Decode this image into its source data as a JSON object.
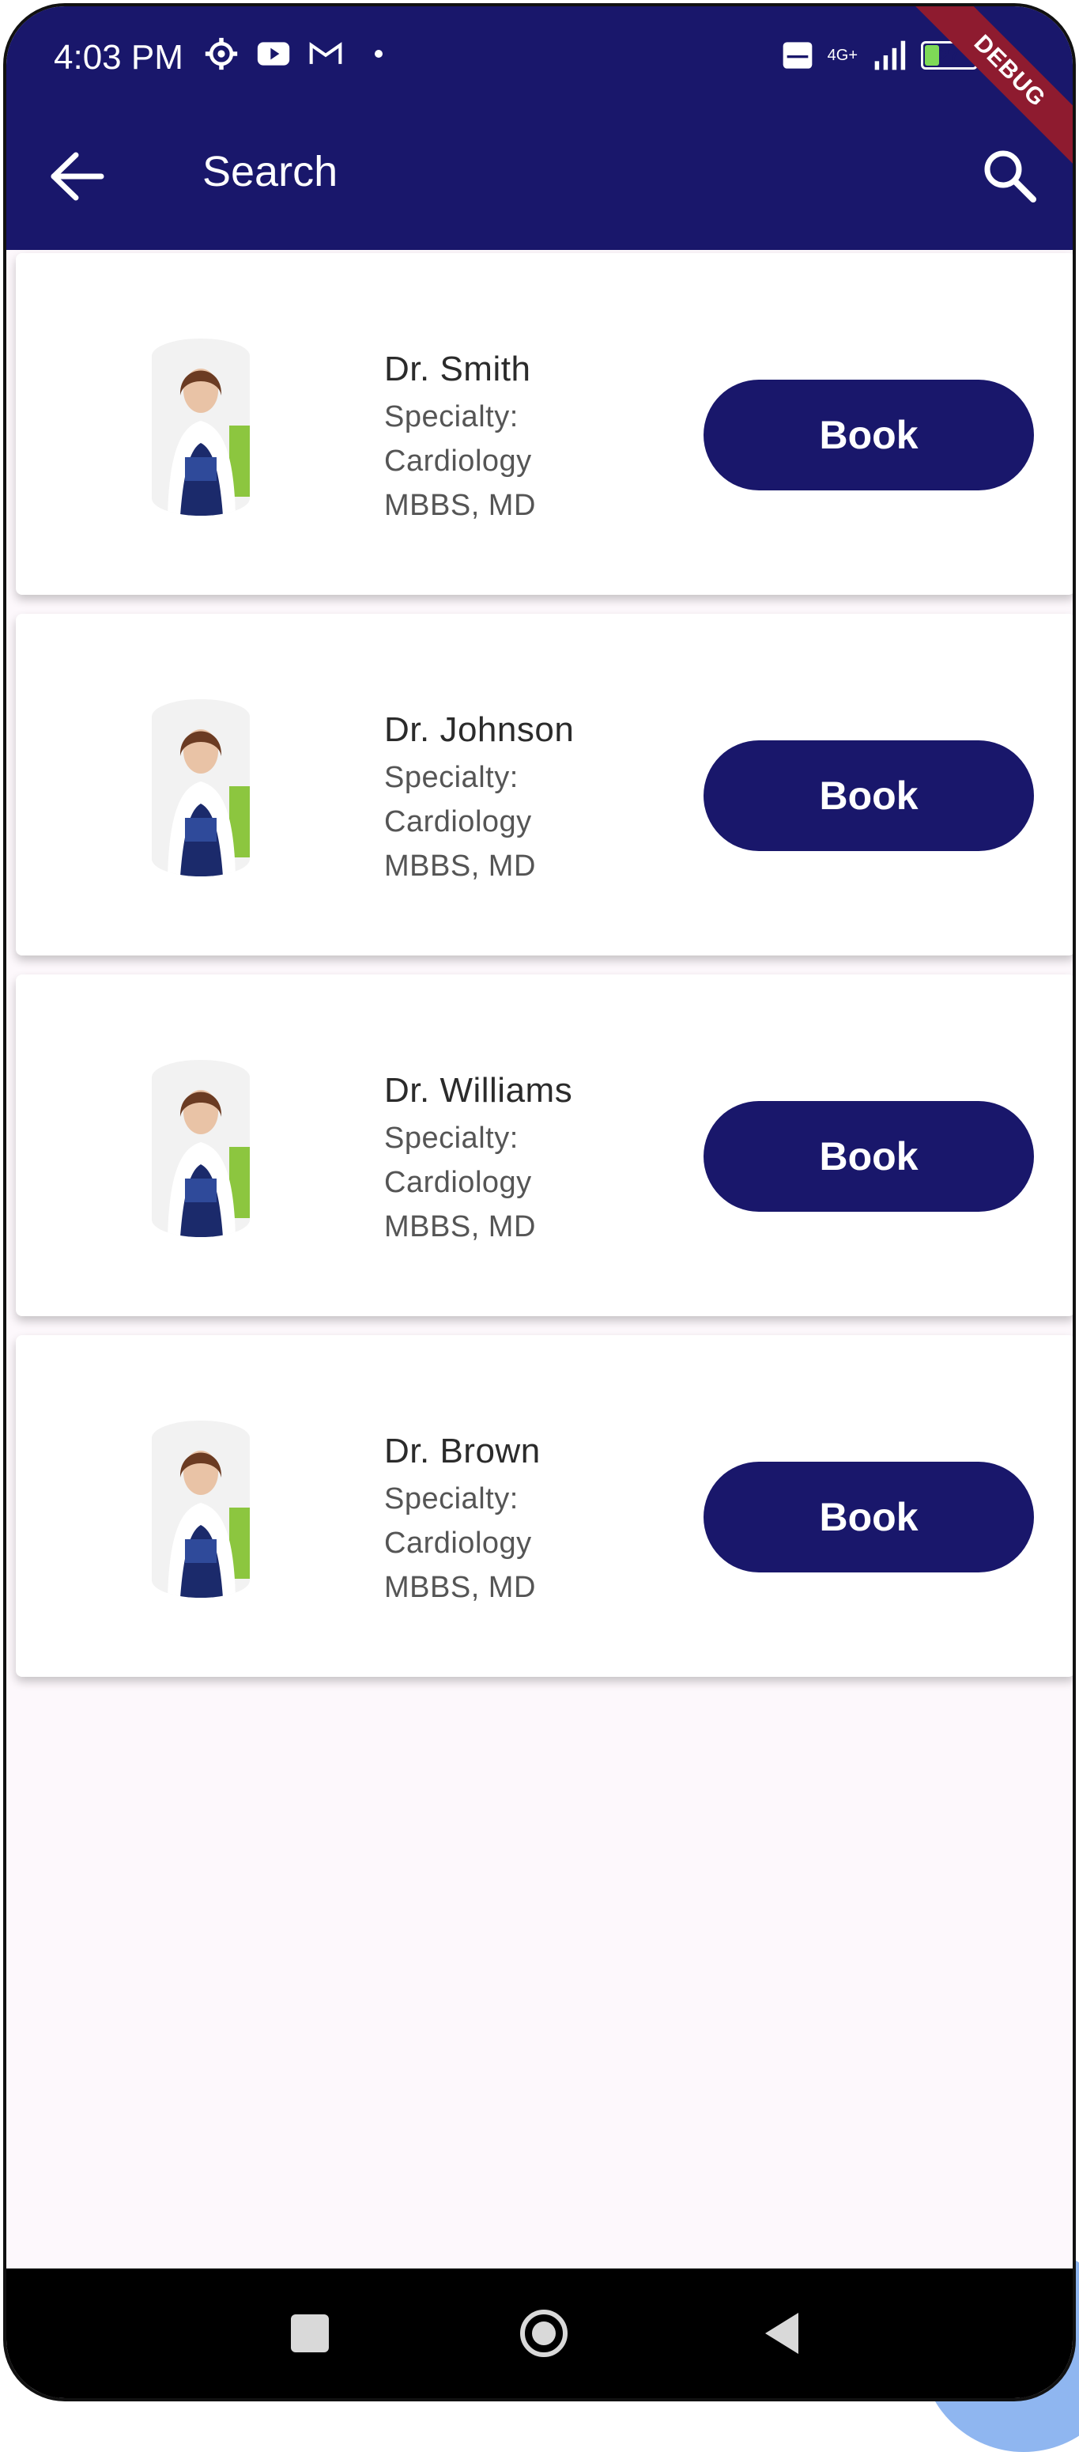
{
  "status_bar": {
    "time": "4:03 PM",
    "network": "4G+",
    "battery": "27",
    "icons": [
      "settings-gear-icon",
      "youtube-icon",
      "gmail-icon",
      "volte-icon",
      "signal-icon",
      "battery-icon"
    ]
  },
  "debug_banner": "DEBUG",
  "app_bar": {
    "title": "Search",
    "back_icon": "arrow-back-icon",
    "search_icon": "search-icon",
    "color": "#19176B"
  },
  "doctors": [
    {
      "name": "Dr. Smith",
      "specialty_label": "Specialty:",
      "specialty": "Cardiology",
      "degree": "MBBS, MD",
      "button": "Book"
    },
    {
      "name": "Dr. Johnson",
      "specialty_label": "Specialty:",
      "specialty": "Cardiology",
      "degree": "MBBS, MD",
      "button": "Book"
    },
    {
      "name": "Dr. Williams",
      "specialty_label": "Specialty:",
      "specialty": "Cardiology",
      "degree": "MBBS, MD",
      "button": "Book"
    },
    {
      "name": "Dr. Brown",
      "specialty_label": "Specialty:",
      "specialty": "Cardiology",
      "degree": "MBBS, MD",
      "button": "Book"
    }
  ],
  "nav_bar": {
    "icons": [
      "recents-square-icon",
      "home-circle-icon",
      "back-triangle-icon"
    ]
  }
}
